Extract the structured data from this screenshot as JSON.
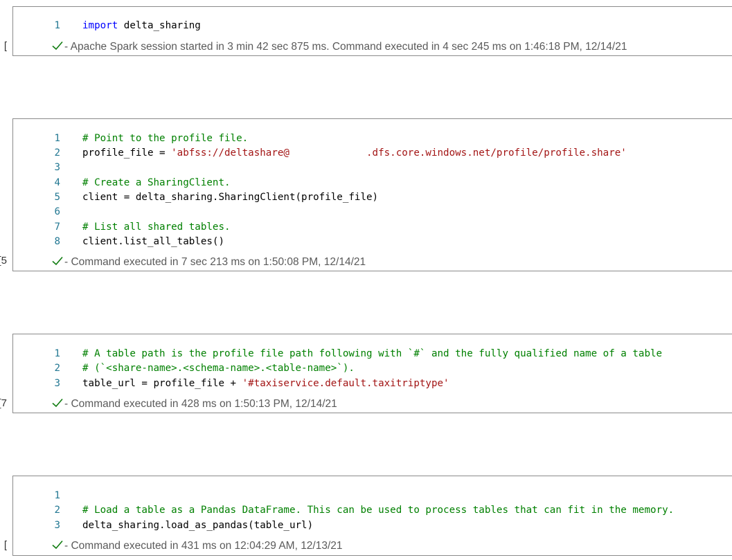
{
  "colors": {
    "line_number": "#237893",
    "keyword": "#0000ff",
    "comment": "#008000",
    "string": "#a31515",
    "check": "#107c10"
  },
  "cells": [
    {
      "exec_count": "]",
      "lines": [
        {
          "num": "1",
          "tokens": [
            {
              "t": "kw",
              "v": "import"
            },
            {
              "t": "pl",
              "v": " delta_sharing"
            }
          ]
        }
      ],
      "status": "- Apache Spark session started in 3 min 42 sec 875 ms. Command executed in 4 sec 245 ms on 1:46:18 PM, 12/14/21"
    },
    {
      "exec_count": "5]",
      "lines": [
        {
          "num": "1",
          "tokens": [
            {
              "t": "cm",
              "v": "# Point to the profile file."
            }
          ]
        },
        {
          "num": "2",
          "tokens": [
            {
              "t": "pl",
              "v": "profile_file = "
            },
            {
              "t": "st",
              "v": "'abfss://deltashare@"
            },
            {
              "t": "gap",
              "v": "             "
            },
            {
              "t": "st",
              "v": ".dfs.core.windows.net/profile/profile.share'"
            }
          ]
        },
        {
          "num": "3",
          "tokens": []
        },
        {
          "num": "4",
          "tokens": [
            {
              "t": "cm",
              "v": "# Create a SharingClient."
            }
          ]
        },
        {
          "num": "5",
          "tokens": [
            {
              "t": "pl",
              "v": "client = delta_sharing.SharingClient(profile_file)"
            }
          ]
        },
        {
          "num": "6",
          "tokens": []
        },
        {
          "num": "7",
          "tokens": [
            {
              "t": "cm",
              "v": "# List all shared tables."
            }
          ]
        },
        {
          "num": "8",
          "tokens": [
            {
              "t": "pl",
              "v": "client.list_all_tables()"
            }
          ]
        }
      ],
      "status": "- Command executed in 7 sec 213 ms on 1:50:08 PM, 12/14/21"
    },
    {
      "exec_count": "7]",
      "lines": [
        {
          "num": "1",
          "tokens": [
            {
              "t": "cm",
              "v": "# A table path is the profile file path following with `#` and the fully qualified name of a table"
            }
          ]
        },
        {
          "num": "2",
          "tokens": [
            {
              "t": "cm",
              "v": "# (`<share-name>.<schema-name>.<table-name>`)."
            }
          ]
        },
        {
          "num": "3",
          "tokens": [
            {
              "t": "pl",
              "v": "table_url = profile_file + "
            },
            {
              "t": "st",
              "v": "'#taxiservice.default.taxitriptype'"
            }
          ]
        }
      ],
      "status": "- Command executed in 428 ms on 1:50:13 PM, 12/14/21"
    },
    {
      "exec_count": "]",
      "lines": [
        {
          "num": "1",
          "tokens": []
        },
        {
          "num": "2",
          "tokens": [
            {
              "t": "cm",
              "v": "# Load a table as a Pandas DataFrame. This can be used to process tables that can fit in the memory."
            }
          ]
        },
        {
          "num": "3",
          "tokens": [
            {
              "t": "pl",
              "v": "delta_sharing.load_as_pandas(table_url)"
            }
          ]
        }
      ],
      "status": "- Command executed in 431 ms on 12:04:29 AM, 12/13/21"
    }
  ]
}
